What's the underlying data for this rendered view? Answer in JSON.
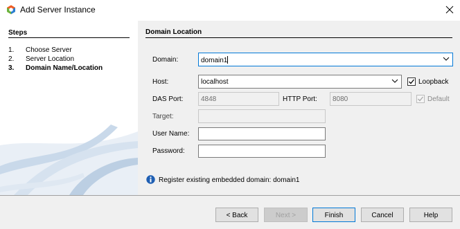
{
  "window": {
    "title": "Add Server Instance"
  },
  "steps": {
    "title": "Steps",
    "items": [
      {
        "num": "1.",
        "label": "Choose Server"
      },
      {
        "num": "2.",
        "label": "Server Location"
      },
      {
        "num": "3.",
        "label": "Domain Name/Location"
      }
    ]
  },
  "panel": {
    "title": "Domain Location"
  },
  "form": {
    "domain_label": "Domain:",
    "domain_value": "domain1",
    "host_label": "Host:",
    "host_value": "localhost",
    "loopback_label": "Loopback",
    "loopback_checked": true,
    "das_port_label": "DAS Port:",
    "das_port_value": "4848",
    "http_port_label": "HTTP Port:",
    "http_port_value": "8080",
    "default_label": "Default",
    "default_checked": true,
    "target_label": "Target:",
    "target_value": "",
    "username_label": "User Name:",
    "username_value": "",
    "password_label": "Password:",
    "password_value": ""
  },
  "info": {
    "message": "Register existing embedded domain: domain1",
    "icon": "info-icon"
  },
  "buttons": {
    "back": "< Back",
    "next": "Next >",
    "finish": "Finish",
    "cancel": "Cancel",
    "help": "Help"
  },
  "colors": {
    "accent": "#0078d7",
    "panel_bg": "#f0f0f0",
    "info_blue": "#1f5fb3"
  }
}
